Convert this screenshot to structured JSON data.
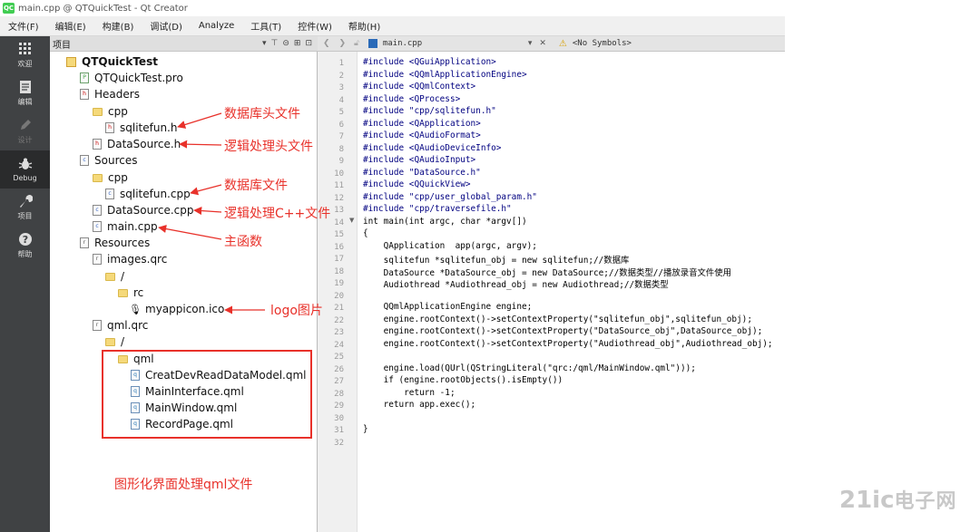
{
  "window": {
    "title": "main.cpp @ QTQuickTest - Qt Creator",
    "logo": "QC"
  },
  "menu": [
    "文件(F)",
    "编辑(E)",
    "构建(B)",
    "调试(D)",
    "Analyze",
    "工具(T)",
    "控件(W)",
    "帮助(H)"
  ],
  "modes": [
    {
      "label": "欢迎",
      "icon": "grid-icon"
    },
    {
      "label": "编辑",
      "icon": "document-icon"
    },
    {
      "label": "设计",
      "icon": "pen-icon"
    },
    {
      "label": "Debug",
      "icon": "bug-icon"
    },
    {
      "label": "项目",
      "icon": "wrench-icon"
    },
    {
      "label": "帮助",
      "icon": "help-icon"
    }
  ],
  "panel": {
    "title": "项目"
  },
  "tree": [
    {
      "label": "QTQuickTest",
      "type": "project"
    },
    {
      "label": "QTQuickTest.pro",
      "type": "pro",
      "badge": "P"
    },
    {
      "label": "Headers",
      "type": "h",
      "badge": "h"
    },
    {
      "label": "cpp",
      "type": "folder"
    },
    {
      "label": "sqlitefun.h",
      "type": "h",
      "badge": "h"
    },
    {
      "label": "DataSource.h",
      "type": "h",
      "badge": "h"
    },
    {
      "label": "Sources",
      "type": "cpp",
      "badge": "c"
    },
    {
      "label": "cpp",
      "type": "folder"
    },
    {
      "label": "sqlitefun.cpp",
      "type": "cpp",
      "badge": "c"
    },
    {
      "label": "DataSource.cpp",
      "type": "cpp",
      "badge": "c"
    },
    {
      "label": "main.cpp",
      "type": "cpp",
      "badge": "c"
    },
    {
      "label": "Resources",
      "type": "qrc",
      "badge": "r"
    },
    {
      "label": "images.qrc",
      "type": "qrc",
      "badge": "r"
    },
    {
      "label": "/",
      "type": "folder"
    },
    {
      "label": "rc",
      "type": "folder"
    },
    {
      "label": "myappicon.ico",
      "type": "mic"
    },
    {
      "label": "qml.qrc",
      "type": "qrc",
      "badge": "r"
    },
    {
      "label": "/",
      "type": "folder"
    },
    {
      "label": "qml",
      "type": "folder"
    },
    {
      "label": "CreatDevReadDataModel.qml",
      "type": "qml",
      "badge": "q"
    },
    {
      "label": "MainInterface.qml",
      "type": "qml",
      "badge": "q"
    },
    {
      "label": "MainWindow.qml",
      "type": "qml",
      "badge": "q"
    },
    {
      "label": "RecordPage.qml",
      "type": "qml",
      "badge": "q"
    }
  ],
  "annotations": [
    "数据库头文件",
    "逻辑处理头文件",
    "数据库文件",
    "逻辑处理C++文件",
    "主函数",
    "logo图片",
    "图形化界面处理qml文件"
  ],
  "editor": {
    "filename": "main.cpp",
    "symbols": "<No Symbols>"
  },
  "line_numbers": [
    "1",
    "2",
    "3",
    "4",
    "5",
    "6",
    "7",
    "8",
    "9",
    "10",
    "11",
    "12",
    "13",
    "14",
    "15",
    "16",
    "17",
    "18",
    "19",
    "20",
    "21",
    "22",
    "23",
    "24",
    "25",
    "26",
    "27",
    "28",
    "29",
    "30",
    "31",
    "32"
  ],
  "code_lines": [
    "#include <QGuiApplication>",
    "#include <QQmlApplicationEngine>",
    "#include <QQmlContext>",
    "#include <QProcess>",
    "#include \"cpp/sqlitefun.h\"",
    "#include <QApplication>",
    "#include <QAudioFormat>",
    "#include <QAudioDeviceInfo>",
    "#include <QAudioInput>",
    "#include \"DataSource.h\"",
    "#include <QQuickView>",
    "#include \"cpp/user_global_param.h\"",
    "#include \"cpp/traversefile.h\"",
    "int main(int argc, char *argv[])",
    "{",
    "    QApplication  app(argc, argv);",
    "    sqlitefun *sqlitefun_obj = new sqlitefun;//数据库",
    "    DataSource *DataSource_obj = new DataSource;//数据类型//播放录音文件使用",
    "    Audiothread *Audiothread_obj = new Audiothread;//数据类型",
    "",
    "    QQmlApplicationEngine engine;",
    "    engine.rootContext()->setContextProperty(\"sqlitefun_obj\",sqlitefun_obj);",
    "    engine.rootContext()->setContextProperty(\"DataSource_obj\",DataSource_obj);",
    "    engine.rootContext()->setContextProperty(\"Audiothread_obj\",Audiothread_obj);",
    "",
    "    engine.load(QUrl(QStringLiteral(\"qrc:/qml/MainWindow.qml\")));",
    "    if (engine.rootObjects().isEmpty())",
    "        return -1;",
    "    return app.exec();",
    "",
    "}",
    ""
  ],
  "watermark": {
    "brand": "21ic",
    "cn": "电子网"
  },
  "colors": {
    "annotation": "#e8312a",
    "modebar": "#404244",
    "folder": "#f5d97a"
  }
}
